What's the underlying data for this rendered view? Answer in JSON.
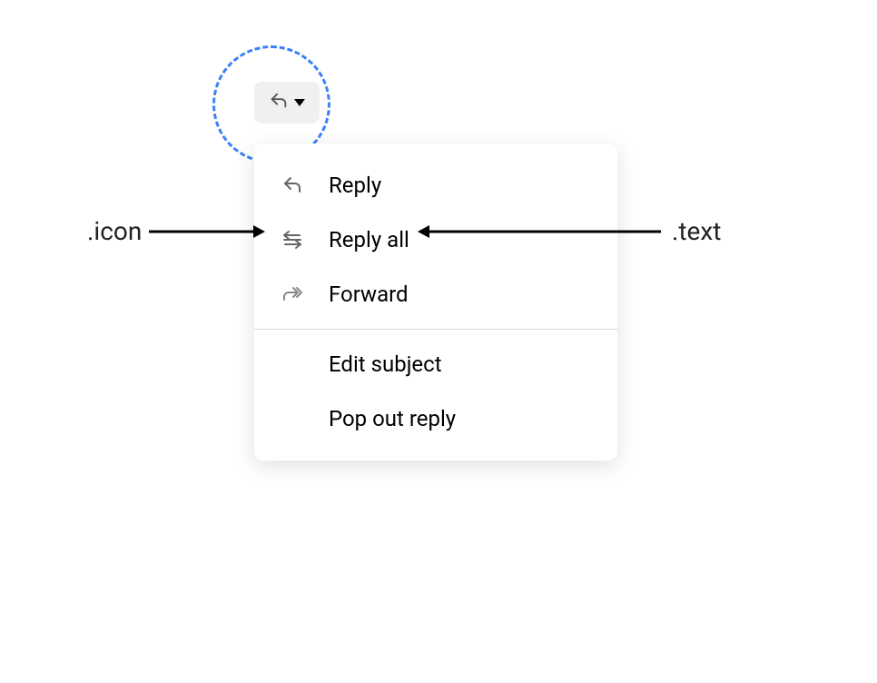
{
  "annotations": {
    "icon_label": ".icon",
    "text_label": ".text"
  },
  "menu": {
    "items": [
      {
        "label": "Reply",
        "icon": "reply-icon"
      },
      {
        "label": "Reply all",
        "icon": "reply-all-icon"
      },
      {
        "label": "Forward",
        "icon": "forward-icon"
      },
      {
        "label": "Edit subject"
      },
      {
        "label": "Pop out reply"
      }
    ]
  }
}
